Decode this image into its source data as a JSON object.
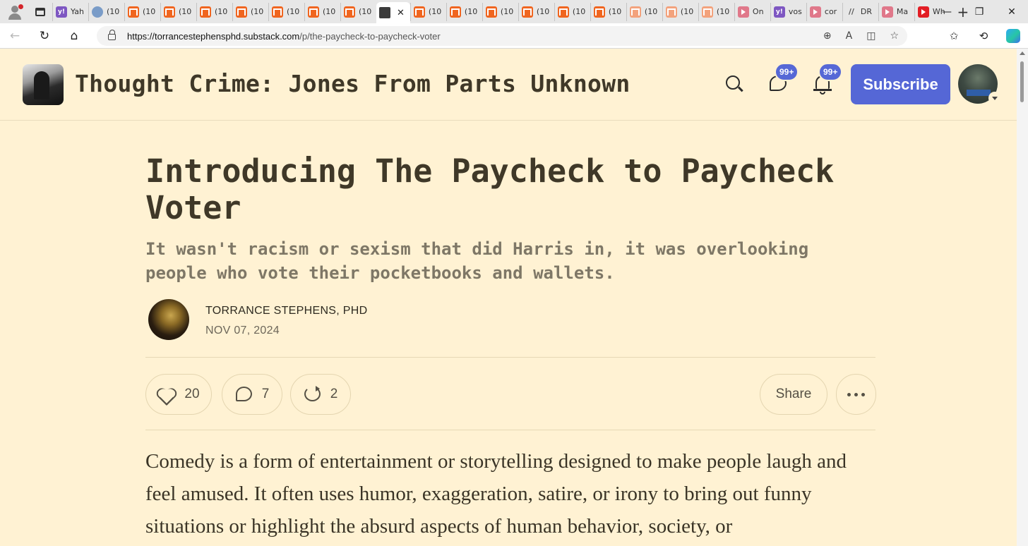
{
  "browser": {
    "tabs": [
      {
        "label": "Yah",
        "favicon": "yahoo-icon"
      },
      {
        "label": "(10",
        "favicon": "globe-icon"
      },
      {
        "label": "(10",
        "favicon": "substack-icon"
      },
      {
        "label": "(10",
        "favicon": "substack-icon"
      },
      {
        "label": "(10",
        "favicon": "substack-icon"
      },
      {
        "label": "(10",
        "favicon": "substack-icon"
      },
      {
        "label": "(10",
        "favicon": "substack-icon"
      },
      {
        "label": "(10",
        "favicon": "substack-icon"
      },
      {
        "label": "(10",
        "favicon": "substack-icon"
      },
      {
        "label": "",
        "favicon": "photo-icon",
        "active": true
      },
      {
        "label": "(10",
        "favicon": "substack-icon"
      },
      {
        "label": "(10",
        "favicon": "substack-icon"
      },
      {
        "label": "(10",
        "favicon": "substack-icon"
      },
      {
        "label": "(10",
        "favicon": "substack-icon"
      },
      {
        "label": "(10",
        "favicon": "substack-icon"
      },
      {
        "label": "(10",
        "favicon": "substack-icon"
      },
      {
        "label": "(10",
        "favicon": "substack-light-icon"
      },
      {
        "label": "(10",
        "favicon": "substack-light-icon"
      },
      {
        "label": "(10",
        "favicon": "substack-light-icon"
      },
      {
        "label": "On",
        "favicon": "youtube-light-icon"
      },
      {
        "label": "vos",
        "favicon": "yahoo-icon"
      },
      {
        "label": "cor",
        "favicon": "youtube-light-icon"
      },
      {
        "label": "DR",
        "favicon": "slash-icon"
      },
      {
        "label": "Ma",
        "favicon": "youtube-light-icon"
      },
      {
        "label": "Wh",
        "favicon": "youtube-icon"
      }
    ],
    "new_tab": "+",
    "close_tab": "✕",
    "window_controls": {
      "minimize": "—",
      "restore": "❐",
      "close": "✕"
    },
    "url_host": "https://torrancestephensphd.substack.com",
    "url_path": "/p/the-paycheck-to-paycheck-voter"
  },
  "header": {
    "publication": "Thought Crime: Jones From Parts Unknown",
    "chat_badge": "99+",
    "notif_badge": "99+",
    "subscribe_label": "Subscribe"
  },
  "post": {
    "title": "Introducing The Paycheck to Paycheck Voter",
    "subtitle": "It wasn't racism or sexism that did Harris in, it was overlooking people who vote their pocketbooks and wallets.",
    "author": "TORRANCE STEPHENS, PHD",
    "date": "NOV 07, 2024",
    "likes": "20",
    "comments": "7",
    "restacks": "2",
    "share_label": "Share",
    "body": "Comedy is a form of entertainment or storytelling designed to make people laugh and feel amused. It often uses humor, exaggeration, satire, or irony to bring out funny situations or highlight the absurd aspects of human behavior, society, or"
  },
  "colors": {
    "page_bg": "#fff2d3",
    "accent": "#5567d6",
    "title_text": "#3f3828"
  }
}
